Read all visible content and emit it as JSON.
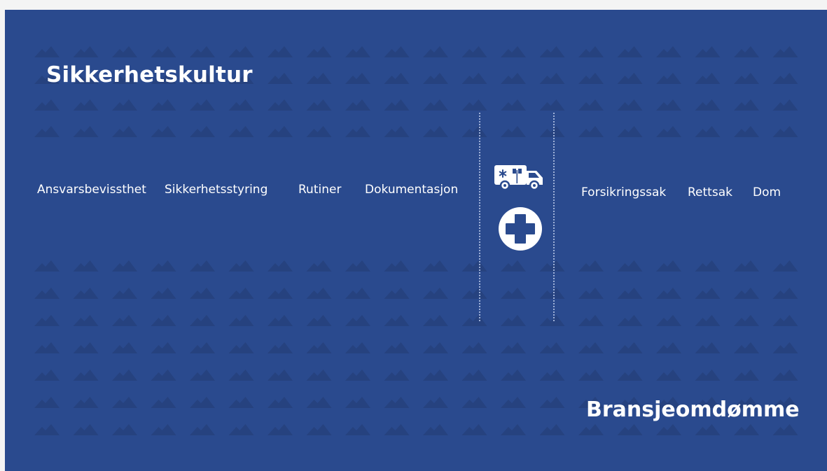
{
  "slide": {
    "title": "Sikkerhetskultur",
    "subtitle": "Bransjeomdømme",
    "background_color": "#2a4a8e",
    "pattern_color": "#26427f"
  },
  "left_items": [
    {
      "label": "Ansvarsbevissthet"
    },
    {
      "label": "Sikkerhetsstyring"
    },
    {
      "label": "Rutiner"
    },
    {
      "label": "Dokumentasjon"
    }
  ],
  "right_items": [
    {
      "label": "Forsikringssak"
    },
    {
      "label": "Rettsak"
    },
    {
      "label": "Dom"
    }
  ],
  "icons": {
    "ambulance": "ambulance-icon",
    "cross": "medical-cross-icon"
  }
}
